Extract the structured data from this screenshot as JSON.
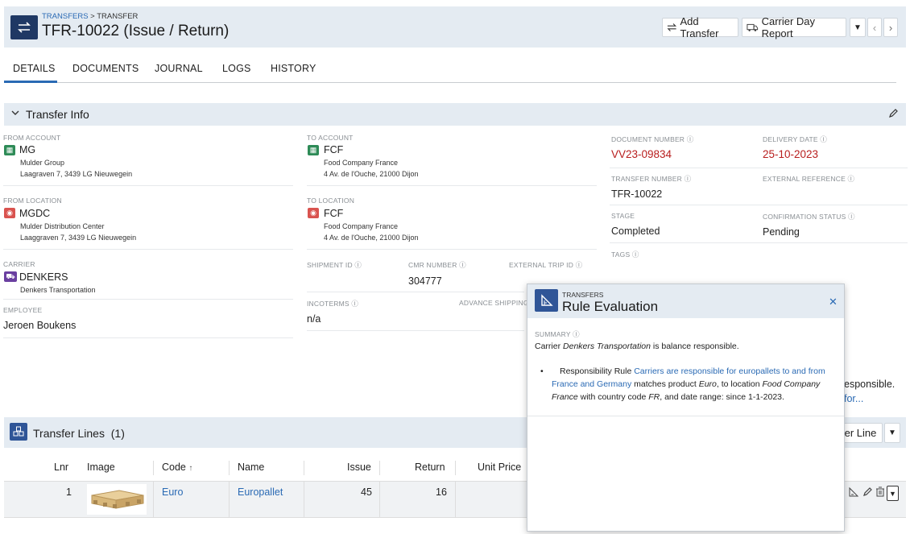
{
  "header": {
    "breadcrumb_root": "TRANSFERS",
    "breadcrumb_sep": " > ",
    "breadcrumb_current": "TRANSFER",
    "title": "TFR-10022 (Issue / Return)",
    "add_transfer": "Add Transfer",
    "carrier_day_report": "Carrier Day Report"
  },
  "tabs": [
    "DETAILS",
    "DOCUMENTS",
    "JOURNAL",
    "LOGS",
    "HISTORY"
  ],
  "transfer_info": {
    "title": "Transfer Info",
    "from_account": {
      "label": "FROM ACCOUNT",
      "code": "MG",
      "name": "Mulder Group",
      "address": "Laagraven 7, 3439 LG Nieuwegein"
    },
    "to_account": {
      "label": "TO ACCOUNT",
      "code": "FCF",
      "name": "Food Company France",
      "address": "4 Av. de l'Ouche, 21000 Dijon"
    },
    "from_location": {
      "label": "FROM LOCATION",
      "code": "MGDC",
      "name": "Mulder Distribution Center",
      "address": "Laaggraven 7, 3439 LG Nieuwegein"
    },
    "to_location": {
      "label": "TO LOCATION",
      "code": "FCF",
      "name": "Food Company France",
      "address": "4 Av. de l'Ouche, 21000 Dijon"
    },
    "carrier": {
      "label": "CARRIER",
      "code": "DENKERS",
      "name": "Denkers Transportation"
    },
    "shipment_id": {
      "label": "SHIPMENT ID"
    },
    "cmr_number": {
      "label": "CMR NUMBER",
      "value": "304777"
    },
    "external_trip_id": {
      "label": "EXTERNAL TRIP ID"
    },
    "employee": {
      "label": "EMPLOYEE",
      "value": "Jeroen Boukens"
    },
    "incoterms": {
      "label": "INCOTERMS",
      "value": "n/a"
    },
    "advance_shipping": {
      "label": "ADVANCE SHIPPING N"
    },
    "document_number": {
      "label": "DOCUMENT NUMBER",
      "value": "VV23-09834"
    },
    "delivery_date": {
      "label": "DELIVERY DATE",
      "value": "25-10-2023"
    },
    "transfer_number": {
      "label": "TRANSFER NUMBER",
      "value": "TFR-10022"
    },
    "external_reference": {
      "label": "EXTERNAL REFERENCE"
    },
    "stage": {
      "label": "STAGE",
      "value": "Completed"
    },
    "confirmation_status": {
      "label": "CONFIRMATION STATUS",
      "value": "Pending"
    },
    "tags": {
      "label": "TAGS"
    },
    "behind_text_1": "esponsible.",
    "behind_text_2": "for..."
  },
  "lines": {
    "title": "Transfer Lines",
    "count": "(1)",
    "add_line_partial": "fer Line",
    "columns": {
      "lnr": "Lnr",
      "image": "Image",
      "code": "Code",
      "name": "Name",
      "issue": "Issue",
      "return": "Return",
      "unit_price": "Unit Price"
    },
    "rows": [
      {
        "lnr": "1",
        "code": "Euro",
        "name": "Europallet",
        "issue": "45",
        "return": "16"
      }
    ]
  },
  "popup": {
    "category": "TRANSFERS",
    "title": "Rule Evaluation",
    "summary_label": "SUMMARY",
    "summary_pre": "Carrier ",
    "summary_carrier": "Denkers Transportation",
    "summary_post": " is balance responsible.",
    "bullet_pre": "Responsibility Rule ",
    "bullet_link": "Carriers are responsible for europallets to and from France and Germany",
    "bullet_mid1": " matches product ",
    "bullet_product": "Euro",
    "bullet_mid2": ", to location ",
    "bullet_location": "Food Company France",
    "bullet_mid3": " with country code ",
    "bullet_country": "FR",
    "bullet_end": ", and date range: since 1-1-2023."
  },
  "colors": {
    "accent": "#2a6ab4",
    "header_bg": "#e4ebf2",
    "brand_dark": "#1f3864",
    "red_value": "#b81e1e",
    "account_green": "#2e8b57",
    "location_red": "#d9534f",
    "carrier_purple": "#6a3fa0"
  }
}
